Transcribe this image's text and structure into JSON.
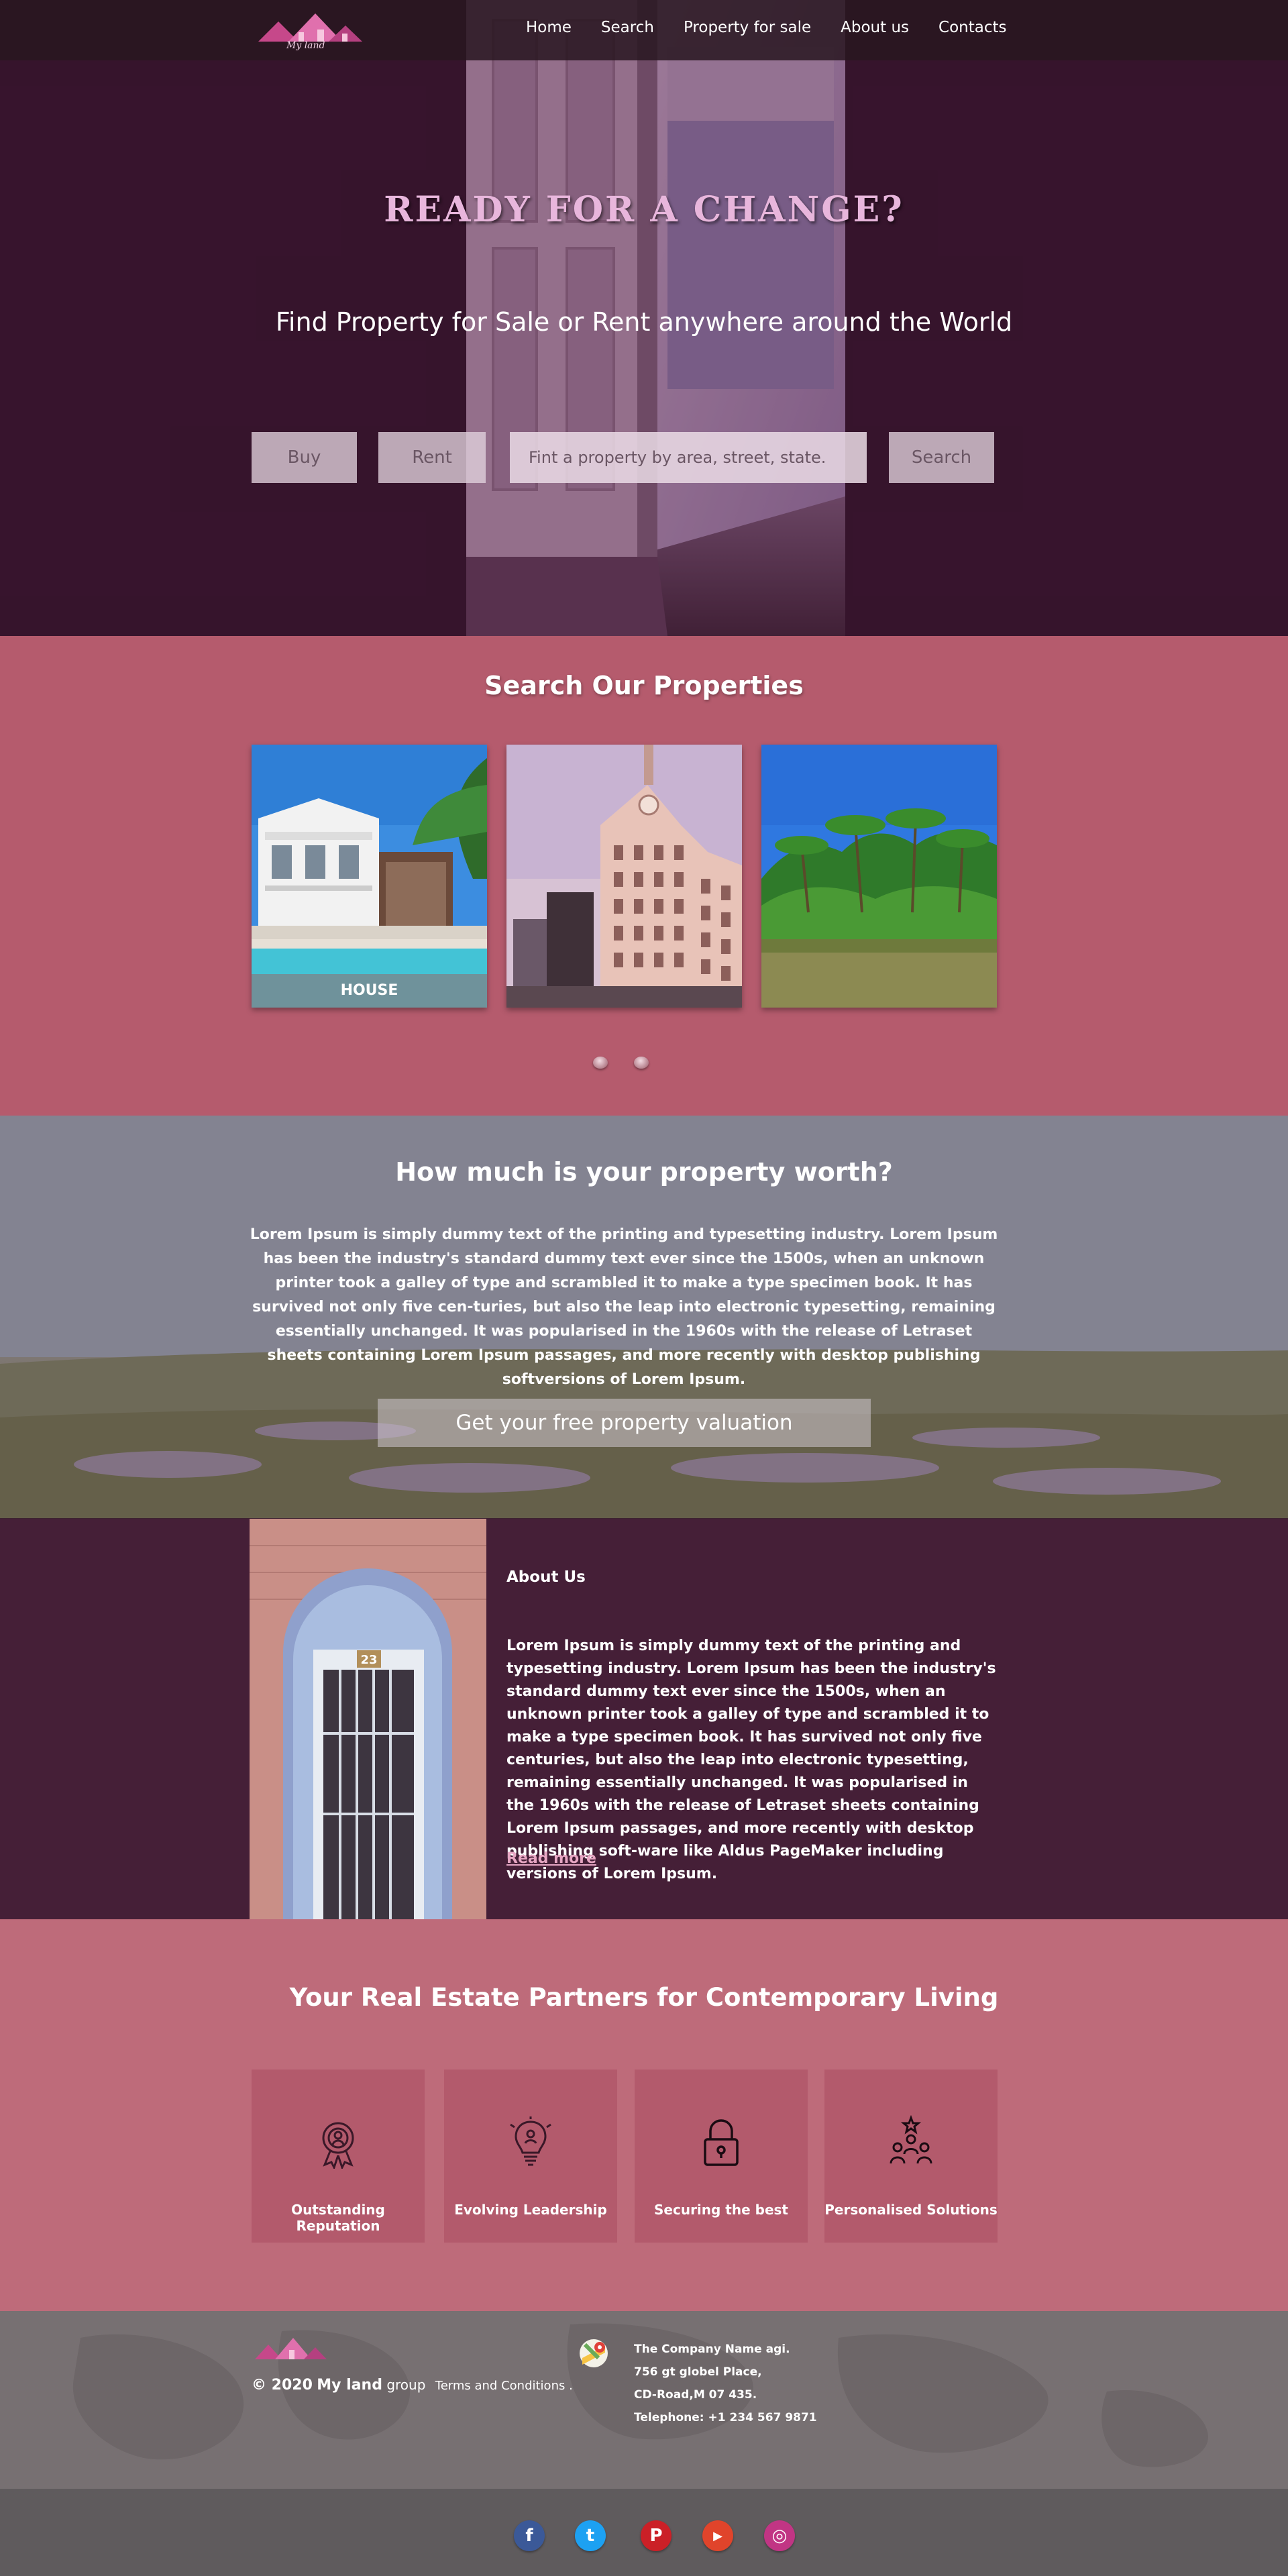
{
  "nav": {
    "logo_text": "My land",
    "links": [
      "Home",
      "Search",
      "Property for sale",
      "About us",
      "Contacts"
    ]
  },
  "hero": {
    "title": "READY FOR A CHANGE?",
    "subtitle": "Find  Property for Sale or Rent anywhere around the World",
    "buy_label": "Buy",
    "rent_label": "Rent",
    "search_placeholder": "Fint a property by area, street, state.",
    "search_label": "Search"
  },
  "properties": {
    "title": "Search Our Properties",
    "cards": [
      {
        "label": "HOUSE",
        "image": "house-with-pool"
      },
      {
        "label": "",
        "image": "city-building"
      },
      {
        "label": "",
        "image": "tropical-river"
      }
    ]
  },
  "worth": {
    "title": "How much is your property worth?",
    "text": "Lorem Ipsum is simply dummy text of the printing and typesetting industry. Lorem Ipsum has been the industry's standard dummy text ever since the 1500s, when an unknown printer took a galley of type and scrambled it to make a type specimen book. It has survived not only five cen-turies, but also the leap into electronic typesetting, remaining essentially unchanged. It was popularised in the 1960s with the release of Letraset sheets containing Lorem Ipsum passages, and more recently with desktop publishing softversions of Lorem Ipsum.",
    "button_label": "Get your free property valuation"
  },
  "about": {
    "heading": "About Us",
    "text": "Lorem Ipsum is simply dummy text of the printing and typesetting industry. Lorem Ipsum has been the industry's standard dummy text ever since the 1500s, when an unknown printer took a galley of type and scrambled it to make a type specimen book. It has survived not only five centuries, but also the leap into electronic typesetting, remaining essentially unchanged. It was popularised in the 1960s with the release of Letraset sheets containing Lorem Ipsum passages, and more recently with desktop publishing soft-ware like Aldus PageMaker including versions of Lorem Ipsum.",
    "link_label": "Read more",
    "door_number": "23"
  },
  "partners": {
    "title": "Your Real Estate Partners for Contemporary Living",
    "features": [
      {
        "label": "Outstanding Reputation",
        "icon": "award-medal-icon"
      },
      {
        "label": "Evolving Leadership",
        "icon": "lightbulb-icon"
      },
      {
        "label": "Securing the best",
        "icon": "padlock-icon"
      },
      {
        "label": "Personalised Solutions",
        "icon": "team-star-icon"
      }
    ]
  },
  "footer": {
    "copyright": "© 2020",
    "brand": "My land",
    "group": "group",
    "terms": "Terms and Conditions .",
    "address": [
      "The Company Name agi.",
      "756 gt globel Place,",
      "CD-Road,M 07 435.",
      "Telephone: +1 234 567 9871"
    ]
  },
  "social": [
    {
      "name": "facebook",
      "glyph": "f",
      "color": "#3b5998"
    },
    {
      "name": "twitter",
      "glyph": "t",
      "color": "#1da1f2"
    },
    {
      "name": "pinterest",
      "glyph": "P",
      "color": "#cb2027"
    },
    {
      "name": "youtube",
      "glyph": "▶",
      "color": "#e0442b"
    },
    {
      "name": "instagram",
      "glyph": "◎",
      "color": "#c13584"
    }
  ],
  "colors": {
    "hero_title": "#e8b6dc",
    "properties_bg": "#b55b6d",
    "about_bg": "#451f37",
    "partners_bg": "#be6b7a",
    "feature_bg": "#b35a6c"
  }
}
